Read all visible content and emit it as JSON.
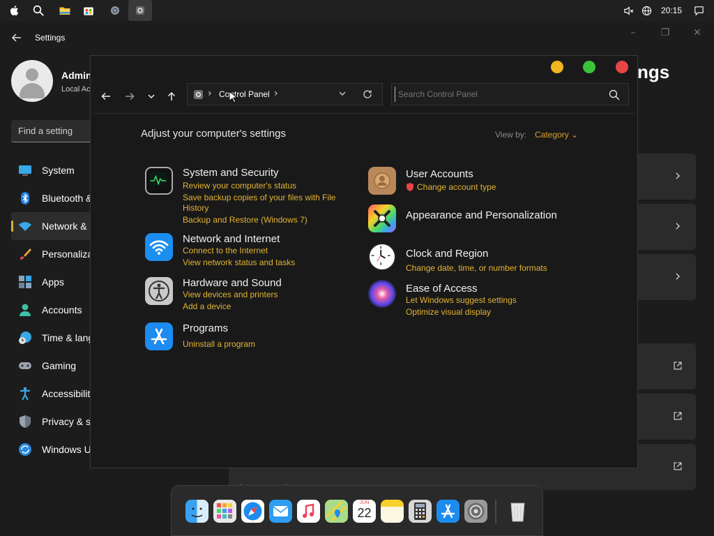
{
  "topbar": {
    "icons": [
      "apple-icon",
      "search-icon",
      "file-explorer-icon",
      "store-icon",
      "settings-icon",
      "control-panel-icon"
    ],
    "clock": "20:15",
    "tray_icons": [
      "notification-muted-icon",
      "globe-icon",
      "message-icon"
    ]
  },
  "settings_window": {
    "title": "Settings",
    "profile_name": "Admin",
    "profile_sub": "Local Ac",
    "search_placeholder": "Find a setting",
    "heading_fragment": "ngs",
    "nav": [
      {
        "label": "System",
        "icon": "monitor-icon"
      },
      {
        "label": "Bluetooth &",
        "icon": "bluetooth-icon"
      },
      {
        "label": "Network &",
        "icon": "wifi-icon",
        "active": true
      },
      {
        "label": "Personaliza",
        "icon": "brush-icon"
      },
      {
        "label": "Apps",
        "icon": "apps-icon"
      },
      {
        "label": "Accounts",
        "icon": "person-icon"
      },
      {
        "label": "Time & lang",
        "icon": "clock-globe-icon"
      },
      {
        "label": "Gaming",
        "icon": "gamepad-icon"
      },
      {
        "label": "Accessibility",
        "icon": "accessibility-icon"
      },
      {
        "label": "Privacy & s",
        "icon": "shield-icon"
      },
      {
        "label": "Windows U",
        "icon": "update-icon"
      }
    ],
    "footer_text": "Internet options"
  },
  "control_panel": {
    "breadcrumb": "Control Panel",
    "search_placeholder": "Search Control Panel",
    "heading": "Adjust your computer's settings",
    "view_by_label": "View by:",
    "view_by_value": "Category",
    "categories_left": [
      {
        "title": "System and Security",
        "icon": "activity-monitor-icon",
        "links": [
          "Review your computer's status",
          "Save backup copies of your files with File",
          "History",
          "Backup and Restore (Windows 7)"
        ]
      },
      {
        "title": "Network and Internet",
        "icon": "wifi-icon",
        "links": [
          "Connect to the Internet",
          "View network status and tasks"
        ]
      },
      {
        "title": "Hardware and Sound",
        "icon": "accessibility-icon",
        "links": [
          "View devices and printers",
          "Add a device"
        ]
      },
      {
        "title": "Programs",
        "icon": "app-store-icon",
        "links": [
          "Uninstall a program"
        ]
      }
    ],
    "categories_right": [
      {
        "title": "User Accounts",
        "icon": "contacts-icon",
        "links": [
          "Change account type"
        ]
      },
      {
        "title": "Appearance and Personalization",
        "icon": "color-tools-icon",
        "links": []
      },
      {
        "title": "Clock and Region",
        "icon": "clock-icon",
        "links": [
          "Change date, time, or number formats"
        ]
      },
      {
        "title": "Ease of Access",
        "icon": "siri-icon",
        "links": [
          "Let Windows suggest settings",
          "Optimize visual display"
        ]
      }
    ]
  },
  "dock": {
    "items": [
      "finder-icon",
      "launchpad-icon",
      "safari-icon",
      "mail-icon",
      "music-icon",
      "maps-icon",
      "calendar-icon",
      "notes-icon",
      "calculator-icon",
      "app-store-icon",
      "system-settings-icon",
      "trash-icon"
    ],
    "calendar_month": "JUN",
    "calendar_day": "22"
  },
  "colors": {
    "accent": "#e3b433",
    "traffic_yellow": "#f0b51f",
    "traffic_green": "#3bc23b",
    "traffic_red": "#e84545"
  }
}
